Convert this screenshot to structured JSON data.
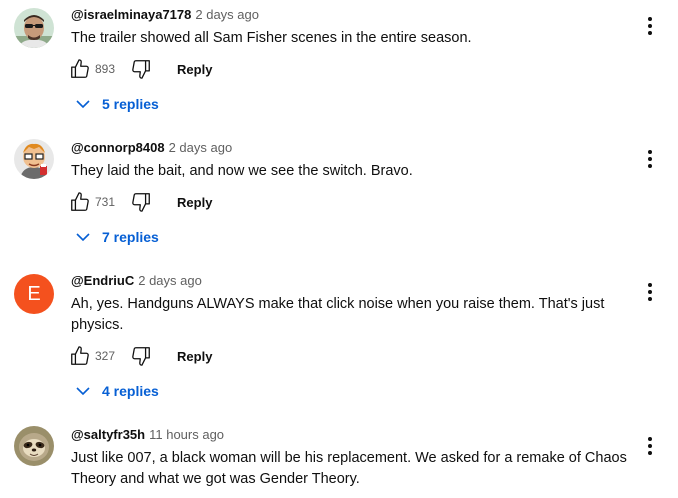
{
  "comments": [
    {
      "author": "@israelminaya7178",
      "time": "2 days ago",
      "text": "The trailer showed all Sam Fisher scenes in the entire season.",
      "likes": "893",
      "reply_label": "Reply",
      "replies_label": "5 replies",
      "avatar_icon": "man-sunglasses-avatar-icon"
    },
    {
      "author": "@connorp8408",
      "time": "2 days ago",
      "text": "They laid the bait, and now we see the switch. Bravo.",
      "likes": "731",
      "reply_label": "Reply",
      "replies_label": "7 replies",
      "avatar_icon": "cartoon-character-avatar-icon"
    },
    {
      "author": "@EndriuC",
      "time": "2 days ago",
      "text": "Ah, yes. Handguns ALWAYS make that click noise when you raise them. That's just physics.",
      "likes": "327",
      "reply_label": "Reply",
      "replies_label": "4 replies",
      "avatar_letter": "E",
      "avatar_color": "#f4511e"
    },
    {
      "author": "@saltyfr35h",
      "time": "11 hours ago",
      "text": "Just like 007, a black woman will be his replacement. We asked for a remake of Chaos Theory and what we got was Gender Theory.",
      "avatar_icon": "sloth-avatar-icon"
    }
  ],
  "colors": {
    "link_blue": "#065fd4",
    "secondary_text": "#606060",
    "primary_text": "#0f0f0f"
  }
}
